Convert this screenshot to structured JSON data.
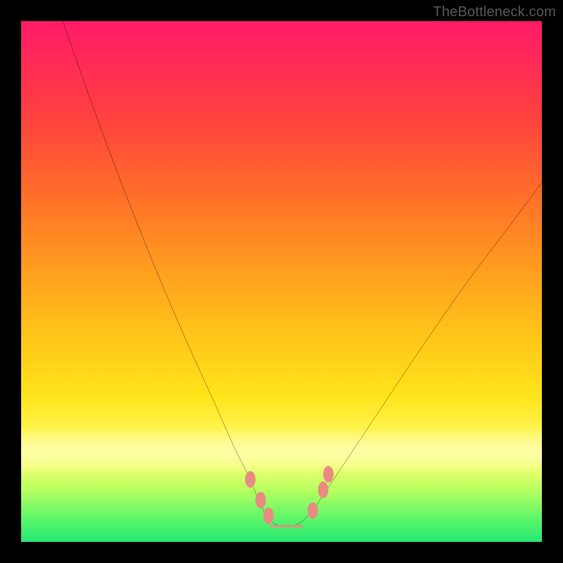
{
  "watermark": "TheBottleneck.com",
  "chart_data": {
    "type": "line",
    "title": "",
    "xlabel": "",
    "ylabel": "",
    "xlim": [
      0,
      100
    ],
    "ylim": [
      0,
      100
    ],
    "series": [
      {
        "name": "bottleneck-curve",
        "x": [
          8,
          14,
          20,
          26,
          32,
          37,
          41,
          44,
          46,
          48,
          50,
          52,
          54,
          56,
          58,
          62,
          68,
          76,
          85,
          94,
          100
        ],
        "y": [
          100,
          83,
          67,
          52,
          38,
          27,
          18,
          12,
          7,
          4,
          3,
          3,
          4,
          6,
          9,
          15,
          24,
          36,
          49,
          61,
          69
        ]
      }
    ],
    "overlays": [
      {
        "name": "valley-markers",
        "color": "#e98b82",
        "points": [
          {
            "x": 44,
            "y": 12
          },
          {
            "x": 46,
            "y": 8
          },
          {
            "x": 47.5,
            "y": 5
          },
          {
            "x": 56,
            "y": 6
          },
          {
            "x": 58,
            "y": 10
          },
          {
            "x": 59,
            "y": 13
          }
        ],
        "segment": {
          "x0": 48,
          "x1": 54,
          "y": 3,
          "thickness": 3
        }
      }
    ],
    "background": {
      "gradient_stops": [
        {
          "pos": 0,
          "color": "#ff1a66"
        },
        {
          "pos": 18,
          "color": "#ff4040"
        },
        {
          "pos": 46,
          "color": "#ff9820"
        },
        {
          "pos": 72,
          "color": "#ffe41a"
        },
        {
          "pos": 90,
          "color": "#b8ff60"
        },
        {
          "pos": 100,
          "color": "#29e876"
        }
      ],
      "pale_band": {
        "top_pct": 78,
        "height_pct": 9
      }
    }
  }
}
